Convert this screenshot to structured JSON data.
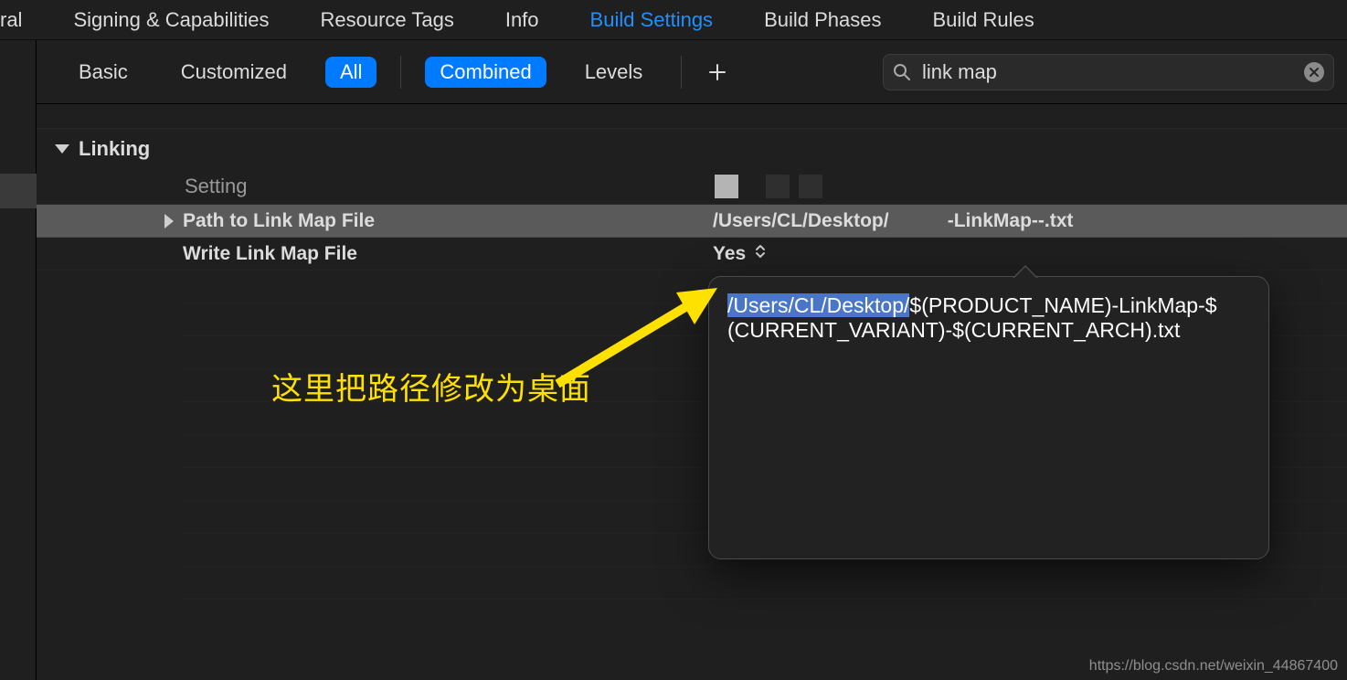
{
  "tabs": {
    "general": "ral",
    "signing": "Signing & Capabilities",
    "resource": "Resource Tags",
    "info": "Info",
    "build_settings": "Build Settings",
    "build_phases": "Build Phases",
    "build_rules": "Build Rules"
  },
  "filter": {
    "basic": "Basic",
    "customized": "Customized",
    "all": "All",
    "combined": "Combined",
    "levels": "Levels",
    "search_value": "link map"
  },
  "section": {
    "title": "Linking",
    "col_setting": "Setting"
  },
  "rows": {
    "path_label": "Path to Link Map File",
    "path_value": "/Users/CL/Desktop/           -LinkMap--.txt",
    "write_label": "Write Link Map File",
    "write_value": "Yes"
  },
  "popover": {
    "highlight": "/Users/CL/Desktop/",
    "rest1": "$(PRODUCT_NAME)-LinkMap-$",
    "rest2": "(CURRENT_VARIANT)-$(CURRENT_ARCH).txt"
  },
  "annotation": "这里把路径修改为桌面",
  "watermark": "https://blog.csdn.net/weixin_44867400"
}
